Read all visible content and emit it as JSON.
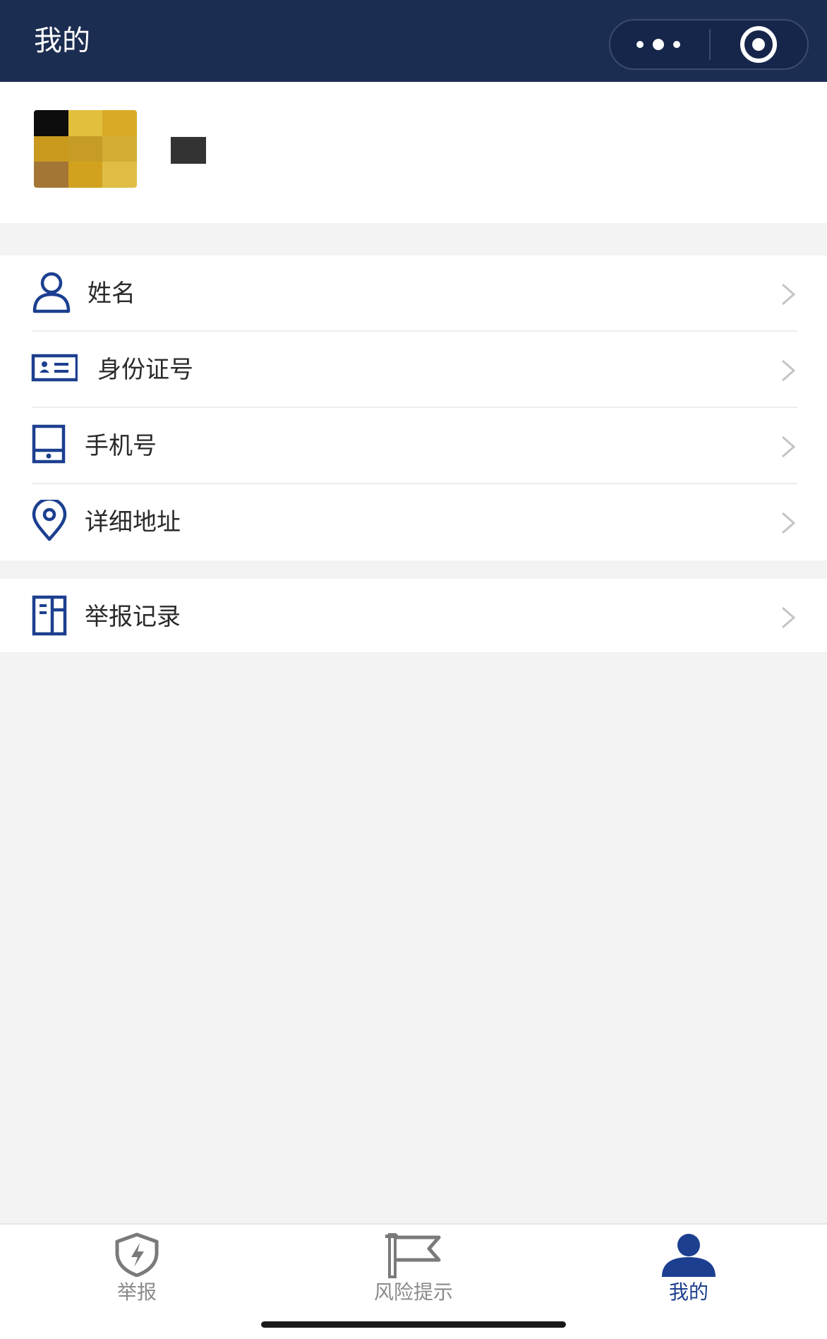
{
  "navbar": {
    "title": "我的",
    "background": "#1c2d52",
    "more_icon": "more-dots-icon",
    "close_icon": "mini-program-close-icon"
  },
  "profile": {
    "avatar": "avatar-image",
    "nickname": ""
  },
  "menu_groups": [
    {
      "items": [
        {
          "label": "姓名",
          "icon": "user-icon"
        },
        {
          "label": "身份证号",
          "icon": "id-card-icon"
        },
        {
          "label": "手机号",
          "icon": "phone-icon"
        },
        {
          "label": "详细地址",
          "icon": "location-pin-icon"
        }
      ]
    },
    {
      "items": [
        {
          "label": "举报记录",
          "icon": "report-record-icon"
        }
      ]
    }
  ],
  "tabbar": {
    "tabs": [
      {
        "label": "举报",
        "icon": "shield-lightning-icon",
        "active": false
      },
      {
        "label": "风险提示",
        "icon": "flag-icon",
        "active": false
      },
      {
        "label": "我的",
        "icon": "user-filled-icon",
        "active": true
      }
    ],
    "active_color": "#1c3f8f",
    "inactive_color": "#8a8a8a"
  },
  "colors": {
    "accent": "#1c3f8f",
    "page_background": "#f3f3f3"
  }
}
